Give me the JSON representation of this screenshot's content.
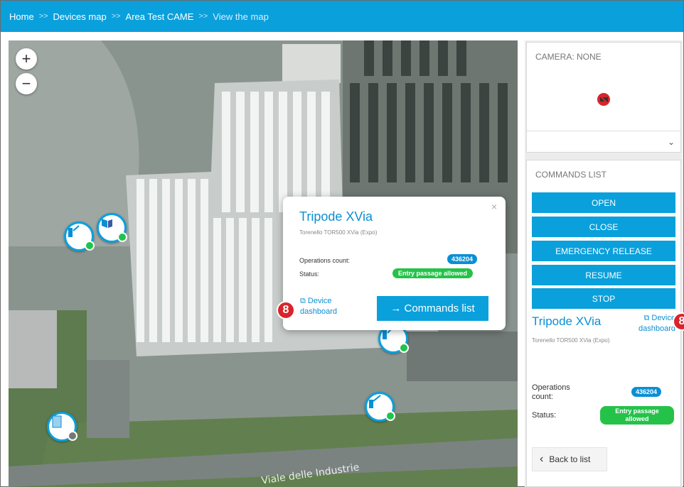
{
  "breadcrumb": {
    "items": [
      "Home",
      "Devices map",
      "Area Test CAME",
      "View the map"
    ],
    "separator": ">>"
  },
  "map": {
    "zoom_in": "+",
    "zoom_out": "−",
    "street_label": "Viale delle Industrie"
  },
  "popup": {
    "close": "×",
    "title": "Tripode XVia",
    "subtitle": "Torenello TOR500 XVia (Expo)",
    "operations_label": "Operations count:",
    "operations_value": "436204",
    "status_label": "Status:",
    "status_value": "Entry passage allowed",
    "dashboard_link": "Device dashboard",
    "commands_button": "→ Commands list",
    "step_number": "8"
  },
  "camera_panel": {
    "title": "CAMERA: NONE",
    "chevron": "⌄"
  },
  "commands_panel": {
    "title": "COMMANDS LIST",
    "buttons": [
      "OPEN",
      "CLOSE",
      "EMERGENCY RELEASE",
      "RESUME",
      "STOP"
    ]
  },
  "device_detail": {
    "title": "Tripode XVia",
    "subtitle": "Torenello TOR500 XVia (Expo)",
    "dashboard_link": "Device dashboard",
    "operations_label": "Operations count:",
    "operations_value": "436204",
    "status_label": "Status:",
    "status_value": "Entry passage allowed",
    "back_button": "Back to list"
  },
  "colors": {
    "accent": "#0aa0dc",
    "status_green": "#25c24a",
    "step_red": "#d7252b"
  }
}
